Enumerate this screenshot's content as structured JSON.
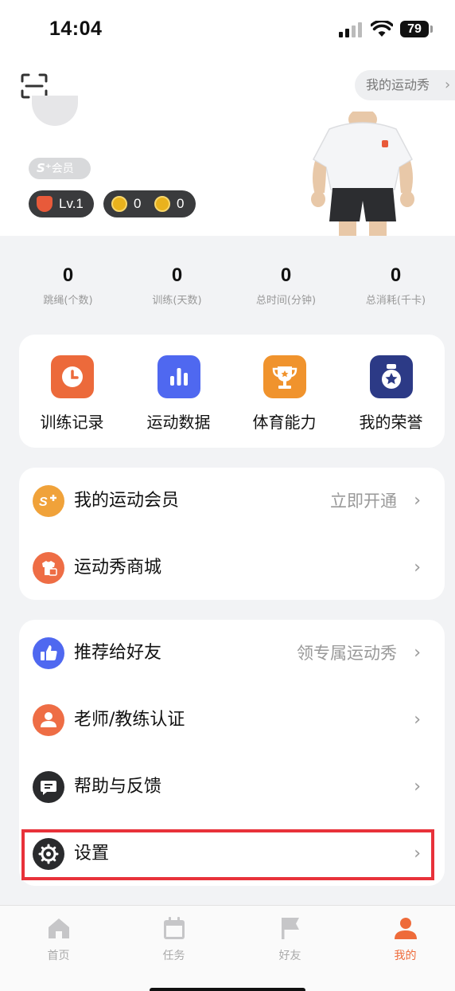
{
  "status_bar": {
    "time": "14:04",
    "battery": "79"
  },
  "header": {
    "show_link": "我的运动秀",
    "chevron": "›"
  },
  "profile": {
    "member_badge_prefix": "S⁺",
    "member_badge_text": "会员",
    "level": "Lv.1",
    "coins_gold": "0",
    "coins_bolt": "0"
  },
  "stats": [
    {
      "value": "0",
      "label": "跳绳(个数)"
    },
    {
      "value": "0",
      "label": "训练(天数)"
    },
    {
      "value": "0",
      "label": "总时间(分钟)"
    },
    {
      "value": "0",
      "label": "总消耗(千卡)"
    }
  ],
  "shortcuts": [
    {
      "label": "训练记录",
      "icon": "clock-icon",
      "color": "#ec6a3b"
    },
    {
      "label": "运动数据",
      "icon": "bar-chart-icon",
      "color": "#4f68f0"
    },
    {
      "label": "体育能力",
      "icon": "trophy-icon",
      "color": "#f0932d"
    },
    {
      "label": "我的荣誉",
      "icon": "medal-icon",
      "color": "#2c3a86"
    }
  ],
  "menu_group_1": [
    {
      "label": "我的运动会员",
      "extra": "立即开通",
      "icon": "svip-icon",
      "color": "#f0a23a"
    },
    {
      "label": "运动秀商城",
      "extra": "",
      "icon": "shop-icon",
      "color": "#ee6d45"
    }
  ],
  "menu_group_2": [
    {
      "label": "推荐给好友",
      "extra": "领专属运动秀",
      "icon": "thumbs-up-icon",
      "color": "#4f68f0"
    },
    {
      "label": "老师/教练认证",
      "extra": "",
      "icon": "teacher-icon",
      "color": "#ee6d45"
    },
    {
      "label": "帮助与反馈",
      "extra": "",
      "icon": "chat-icon",
      "color": "#2a2b2d"
    },
    {
      "label": "设置",
      "extra": "",
      "icon": "gear-icon",
      "color": "#2a2b2d"
    }
  ],
  "tabbar": [
    {
      "label": "首页",
      "icon": "home-icon"
    },
    {
      "label": "任务",
      "icon": "calendar-icon"
    },
    {
      "label": "好友",
      "icon": "flag-icon"
    },
    {
      "label": "我的",
      "icon": "user-icon"
    }
  ],
  "colors": {
    "accent": "#ee6b3a",
    "highlight": "#e8323a"
  }
}
